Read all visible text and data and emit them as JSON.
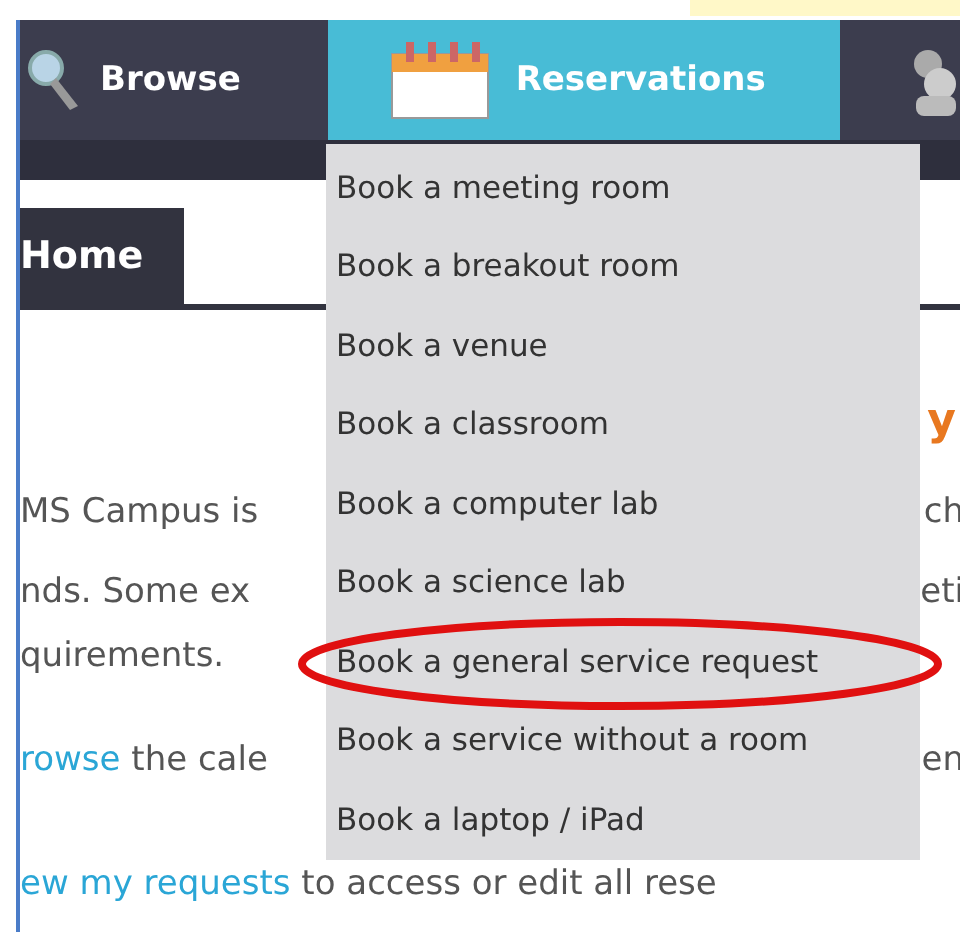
{
  "nav": {
    "tabs": [
      {
        "label": "Browse",
        "selected": false
      },
      {
        "label": "Reservations",
        "selected": true
      },
      {
        "selected": false
      }
    ]
  },
  "home_tab": {
    "label": "Home"
  },
  "heading_fragment": "y",
  "body_lines": [
    {
      "left": "MS Campus is",
      "right": "ch"
    },
    {
      "left": "nds. Some ex",
      "right": "eti"
    },
    {
      "left": "quirements."
    },
    {
      "link": "rowse",
      "left": " the cale",
      "right": "en"
    },
    {
      "link": "ew my requests",
      "left": " to access or edit all rese"
    }
  ],
  "dropdown": {
    "items": [
      {
        "label": "Book a meeting room",
        "circled": false
      },
      {
        "label": "Book a breakout room",
        "circled": false
      },
      {
        "label": "Book a venue",
        "circled": false
      },
      {
        "label": "Book a classroom",
        "circled": false
      },
      {
        "label": "Book a computer lab",
        "circled": false
      },
      {
        "label": "Book a science lab",
        "circled": false
      },
      {
        "label": "Book a general service request",
        "circled": true
      },
      {
        "label": "Book a service without a room",
        "circled": false
      },
      {
        "label": "Book a laptop / iPad",
        "circled": false
      }
    ]
  }
}
